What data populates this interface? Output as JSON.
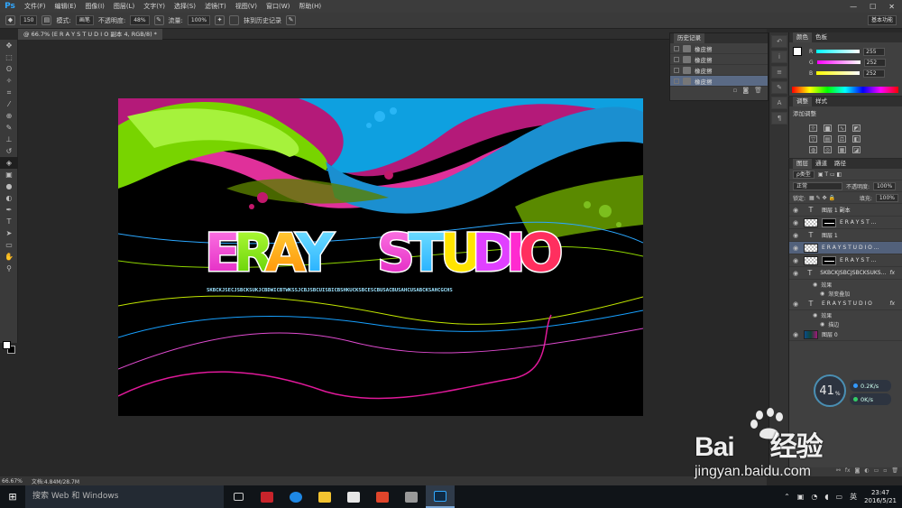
{
  "app": {
    "logo": "Ps",
    "menu": [
      "文件(F)",
      "编辑(E)",
      "图像(I)",
      "图层(L)",
      "文字(Y)",
      "选择(S)",
      "滤镜(T)",
      "视图(V)",
      "窗口(W)",
      "帮助(H)"
    ],
    "window_controls": [
      "—",
      "☐",
      "✕"
    ]
  },
  "options": {
    "brush_size": "150",
    "mode_label": "模式:",
    "mode_value": "画笔",
    "opacity_label": "不透明度:",
    "opacity_value": "48%",
    "flow_label": "流量:",
    "flow_value": "100%",
    "erase_history": "抹到历史记录",
    "workspace": "基本功能"
  },
  "document": {
    "tab_title": "@ 66.7% (E R A Y      S T U D I O   副本 4, RGB/8) *",
    "canvas_title": "ERAY  STUDIO",
    "small_text": "SKBCKJSECJSBCKSUKJCBDWICBTWKSSJCBJSBCUISBICBSHKUCKSBCESCBUSACBUSAHCUSABCKSAHCGCHS"
  },
  "status": {
    "zoom": "66.67%",
    "doc": "文档:4.84M/28.7M"
  },
  "history": {
    "title": "历史记录",
    "items": [
      "橡皮擦",
      "橡皮擦",
      "橡皮擦",
      "橡皮擦"
    ]
  },
  "color_panel": {
    "tabs": [
      "颜色",
      "色板"
    ],
    "channels": [
      {
        "label": "R",
        "value": "255",
        "color": "#00d8ff"
      },
      {
        "label": "G",
        "value": "252",
        "color": "#ff3cff"
      },
      {
        "label": "B",
        "value": "252",
        "color": "#ffff30"
      }
    ]
  },
  "adjust_panel": {
    "tabs": [
      "调整",
      "样式"
    ],
    "add_label": "添加调整"
  },
  "layers_panel": {
    "tabs": [
      "图层",
      "通道",
      "路径"
    ],
    "kind_label": "ρ类型",
    "blend": "正常",
    "opacity_label": "不透明度:",
    "opacity_value": "100%",
    "lock_label": "锁定:",
    "fill_label": "填充:",
    "fill_value": "100%",
    "layers": [
      {
        "type": "text",
        "name": "图层 1 副本",
        "row": "main"
      },
      {
        "type": "masked",
        "name": "E R A Y    S T ...",
        "row": "main"
      },
      {
        "type": "text",
        "name": "图层 1",
        "row": "main"
      },
      {
        "type": "image",
        "name": "E R A Y   S T U D I O ...",
        "row": "selected"
      },
      {
        "type": "masked",
        "name": "E R A Y    S T ...",
        "row": "main"
      },
      {
        "type": "text",
        "name": "SKBCKJSBCJSBCKSUKS...",
        "row": "main",
        "fx": "fx"
      },
      {
        "type": "effects",
        "name": "效果",
        "row": "sub"
      },
      {
        "type": "effect",
        "name": "渐变叠加",
        "row": "sub2"
      },
      {
        "type": "text",
        "name": "E R A Y    S T U D I O",
        "row": "main",
        "fx": "fx"
      },
      {
        "type": "effects",
        "name": "效果",
        "row": "sub"
      },
      {
        "type": "effect",
        "name": "描边",
        "row": "sub2"
      },
      {
        "type": "bg",
        "name": "图层 0",
        "row": "main"
      }
    ]
  },
  "speed": {
    "percent": "41",
    "percent_sign": "%",
    "up": "0.2K/s",
    "down": "0K/s"
  },
  "watermark": {
    "brand_a": "Bai",
    "brand_b": "经验",
    "url": "jingyan.baidu.com"
  },
  "taskbar": {
    "search": "搜索 Web 和 Windows",
    "ime": "英",
    "time": "23:47",
    "date": "2016/5/21"
  }
}
